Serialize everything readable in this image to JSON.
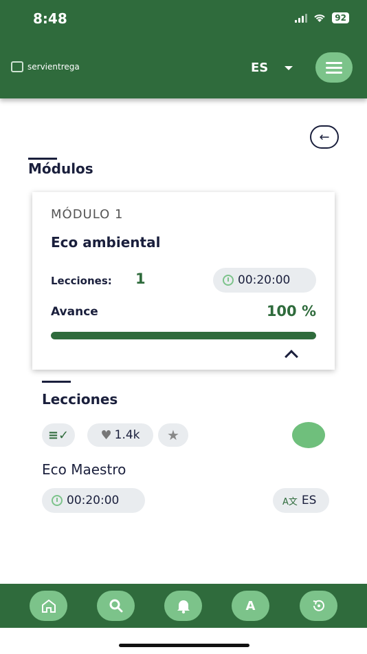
{
  "status_bar": {
    "time": "8:48",
    "battery": "92"
  },
  "header": {
    "brand": "servientrega",
    "language": "ES"
  },
  "section_modules": {
    "title": "Módulos"
  },
  "module_card": {
    "label": "MÓDULO 1",
    "title": "Eco ambiental",
    "lessons_label": "Lecciones:",
    "lessons_count": "1",
    "duration": "00:20:00",
    "progress_label": "Avance",
    "progress_text": "100 %",
    "progress_fraction": 1.0
  },
  "section_lessons": {
    "title": "Lecciones"
  },
  "lesson": {
    "likes": "1.4k",
    "name": "Eco Maestro",
    "duration": "00:20:00",
    "language": "ES"
  },
  "bottom_nav": {
    "profile_letter": "A"
  },
  "icons": [
    "home-icon",
    "search-icon",
    "bell-icon",
    "history-icon",
    "list-check-icon",
    "heart-icon",
    "star-icon",
    "clock-icon",
    "translate-icon",
    "back-arrow-icon",
    "menu-icon"
  ],
  "colors": {
    "primary": "#2f6b3c",
    "accent": "#7cc38a",
    "text": "#1a1f3c"
  }
}
